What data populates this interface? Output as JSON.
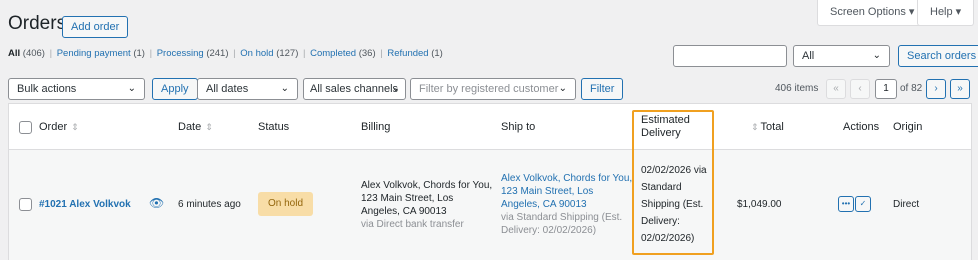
{
  "page": {
    "title": "Orders",
    "add_order_label": "Add order"
  },
  "screen_options": {
    "screen_options_label": "Screen Options ▾",
    "help_label": "Help ▾"
  },
  "status_filters": [
    {
      "label": "All",
      "count": "(406)"
    },
    {
      "label": "Pending payment",
      "count": "(1)"
    },
    {
      "label": "Processing",
      "count": "(241)"
    },
    {
      "label": "On hold",
      "count": "(127)"
    },
    {
      "label": "Completed",
      "count": "(36)"
    },
    {
      "label": "Refunded",
      "count": "(1)"
    }
  ],
  "separator": "|",
  "search": {
    "value": "",
    "scope": "All",
    "button_label": "Search orders"
  },
  "filters": {
    "bulk_actions": "Bulk actions",
    "apply_label": "Apply",
    "dates": "All dates",
    "channels": "All sales channels",
    "customer_placeholder": "Filter by registered customer",
    "filter_label": "Filter"
  },
  "pagination": {
    "items": "406 items",
    "first": "«",
    "prev": "‹",
    "current_page": "1",
    "of_total": "of 82",
    "next": "›",
    "last": "»"
  },
  "columns": {
    "order": "Order",
    "date": "Date",
    "status": "Status",
    "billing": "Billing",
    "ship_to": "Ship to",
    "estimated_delivery_line1": "Estimated",
    "estimated_delivery_line2": "Delivery",
    "total": "Total",
    "actions": "Actions",
    "origin": "Origin"
  },
  "rows": [
    {
      "order": "#1021 Alex Volkvok",
      "date": "6 minutes ago",
      "status": "On hold",
      "billing_lines": [
        "Alex Volkvok, Chords for You,",
        "123 Main Street, Los",
        "Angeles, CA 90013"
      ],
      "billing_via": "via Direct bank transfer",
      "ship_lines": [
        "Alex Volkvok, Chords for You,",
        "123 Main Street, Los",
        "Angeles, CA 90013"
      ],
      "ship_via_lines": [
        "via Standard Shipping (Est.",
        "Delivery: 02/02/2026)"
      ],
      "delivery_lines": [
        "02/02/2026 via",
        "Standard",
        "Shipping (Est.",
        "Delivery:",
        "02/02/2026)"
      ],
      "total": "$1,049.00",
      "origin": "Direct"
    }
  ],
  "icons": {
    "preview": "eye-icon",
    "more": "ellipsis-icon",
    "complete": "checkmark-icon",
    "sort": "sort-arrows-icon",
    "dropdown": "chevron-down-icon"
  },
  "colors": {
    "accent": "#2271b1",
    "hold_badge_bg": "#f8dda7",
    "hold_badge_text": "#94660c",
    "highlight": "#f0a020"
  }
}
